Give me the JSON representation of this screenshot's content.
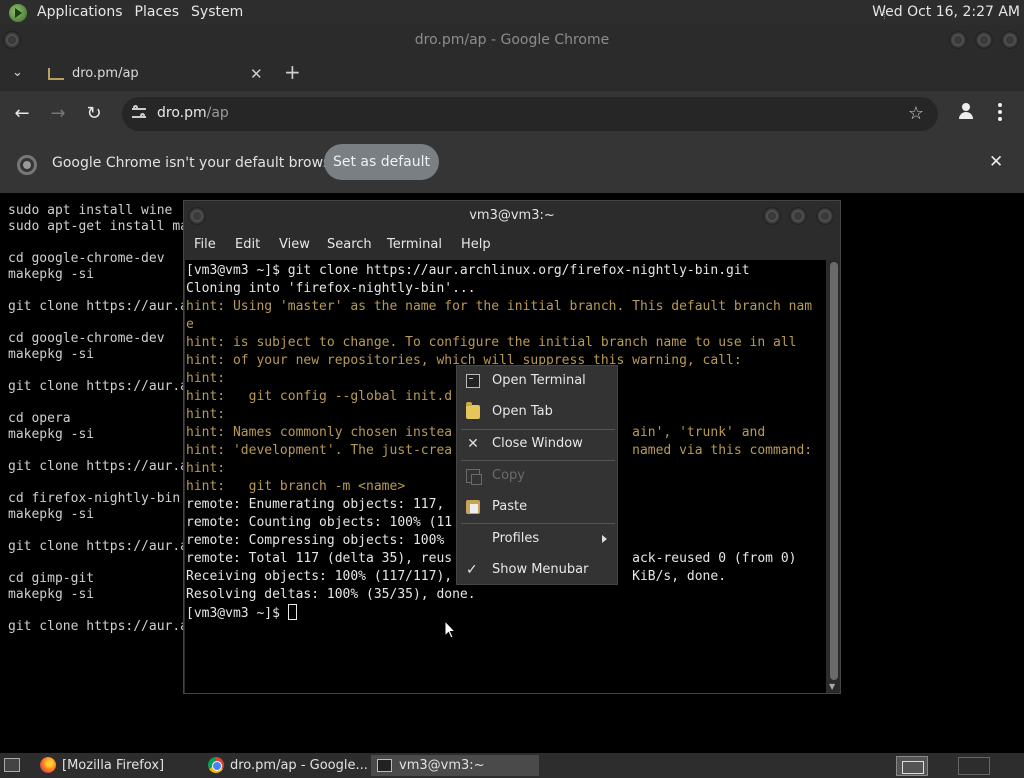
{
  "top_panel": {
    "menus": [
      "Applications",
      "Places",
      "System"
    ],
    "clock": "Wed Oct 16,  2:27 AM"
  },
  "chrome": {
    "window_title": "dro.pm/ap - Google Chrome",
    "tab_title": "dro.pm/ap",
    "url_host": "dro.pm",
    "url_path": "/ap",
    "infobar_text": "Google Chrome isn't your default browser",
    "infobar_button": "Set as default"
  },
  "page_code": "sudo apt install wine\nsudo apt-get install ma\n\ncd google-chrome-dev\nmakepkg -si\n\ngit clone https://aur.a\n\ncd google-chrome-dev\nmakepkg -si\n\ngit clone https://aur.a\n\ncd opera\nmakepkg -si\n\ngit clone https://aur.a\n\ncd firefox-nightly-bin\nmakepkg -si\n\ngit clone https://aur.a\n\ncd gimp-git\nmakepkg -si\n\ngit clone https://aur.a",
  "terminal": {
    "title": "vm3@vm3:~",
    "menus": [
      "File",
      "Edit",
      "View",
      "Search",
      "Terminal",
      "Help"
    ],
    "lines": [
      {
        "text": "[vm3@vm3 ~]$ git clone https://aur.archlinux.org/firefox-nightly-bin.git",
        "hint": false
      },
      {
        "text": "Cloning into 'firefox-nightly-bin'...",
        "hint": false
      },
      {
        "text": "hint: Using 'master' as the name for the initial branch. This default branch nam",
        "hint": true
      },
      {
        "text": "e",
        "hint": true
      },
      {
        "text": "hint: is subject to change. To configure the initial branch name to use in all",
        "hint": true
      },
      {
        "text": "hint: of your new repositories, which will suppress this warning, call:",
        "hint": true
      },
      {
        "text": "hint:",
        "hint": true
      },
      {
        "text": "hint:   git config --global init.d",
        "hint": true
      },
      {
        "text": "hint:",
        "hint": true
      },
      {
        "text": "hint: Names commonly chosen instea                       ain', 'trunk' and",
        "hint": true
      },
      {
        "text": "hint: 'development'. The just-crea                       named via this command:",
        "hint": true
      },
      {
        "text": "hint:",
        "hint": true
      },
      {
        "text": "hint:   git branch -m <name>",
        "hint": true
      },
      {
        "text": "remote: Enumerating objects: 117,",
        "hint": false
      },
      {
        "text": "remote: Counting objects: 100% (11",
        "hint": false
      },
      {
        "text": "remote: Compressing objects: 100%",
        "hint": false
      },
      {
        "text": "remote: Total 117 (delta 35), reus                       ack-reused 0 (from 0)",
        "hint": false
      },
      {
        "text": "Receiving objects: 100% (117/117),                       KiB/s, done.",
        "hint": false
      },
      {
        "text": "Resolving deltas: 100% (35/35), done.",
        "hint": false
      }
    ],
    "prompt": "[vm3@vm3 ~]$ "
  },
  "context_menu": {
    "items": [
      {
        "label": "Open Terminal",
        "icon": "terminal-icon",
        "disabled": false
      },
      {
        "label": "Open Tab",
        "icon": "folder-icon",
        "disabled": false
      },
      {
        "label": "Close Window",
        "icon": "close-icon",
        "disabled": false
      },
      {
        "label": "Copy",
        "icon": "copy-icon",
        "disabled": true
      },
      {
        "label": "Paste",
        "icon": "paste-icon",
        "disabled": false
      },
      {
        "label": "Profiles",
        "icon": "",
        "disabled": false
      },
      {
        "label": "Show Menubar",
        "icon": "check-icon",
        "disabled": false
      }
    ]
  },
  "taskbar": {
    "tasks": [
      "[Mozilla Firefox]",
      "dro.pm/ap - Google...",
      "vm3@vm3:~"
    ]
  }
}
